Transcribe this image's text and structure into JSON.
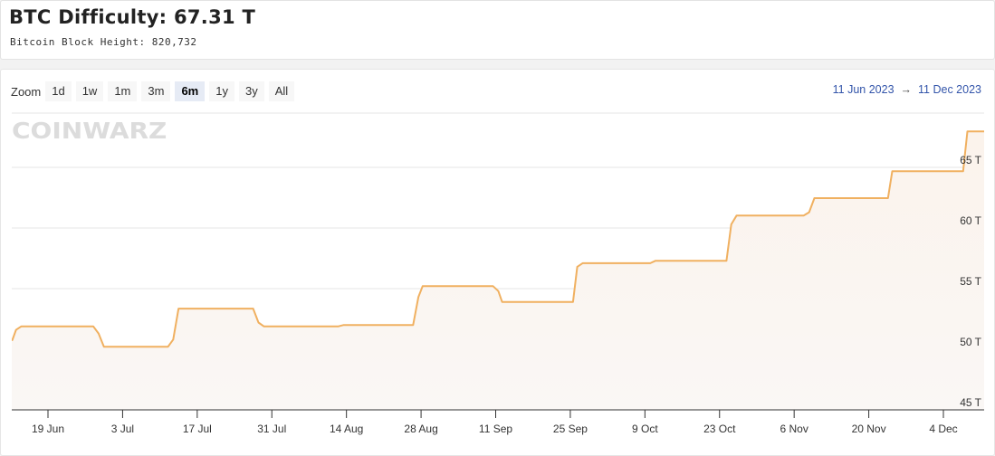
{
  "header": {
    "title": "BTC Difficulty: 67.31 T",
    "subtitle": "Bitcoin Block Height: 820,732"
  },
  "toolbar": {
    "zoom_label": "Zoom",
    "buttons": [
      {
        "label": "1d",
        "active": false
      },
      {
        "label": "1w",
        "active": false
      },
      {
        "label": "1m",
        "active": false
      },
      {
        "label": "3m",
        "active": false
      },
      {
        "label": "6m",
        "active": true
      },
      {
        "label": "1y",
        "active": false
      },
      {
        "label": "3y",
        "active": false
      },
      {
        "label": "All",
        "active": false
      }
    ]
  },
  "range": {
    "from": "11 Jun 2023",
    "arrow": "→",
    "to": "11 Dec 2023"
  },
  "watermark": "COINWARZ",
  "colors": {
    "line": "#f0b060",
    "area": "#fbf3ec",
    "range_text": "#3355aa",
    "active_button": "#e6ebf5"
  },
  "chart_data": {
    "type": "area",
    "title": "BTC Difficulty",
    "xlabel": "",
    "ylabel": "",
    "ylim": [
      45,
      69
    ],
    "y_unit": "T",
    "y_ticks": [
      45,
      50,
      55,
      60,
      65
    ],
    "y_tick_labels": [
      "45 T",
      "50 T",
      "55 T",
      "60 T",
      "65 T"
    ],
    "x_range_days": [
      0,
      183
    ],
    "x_ticks": [
      {
        "day": 8,
        "label": "19 Jun"
      },
      {
        "day": 22,
        "label": "3 Jul"
      },
      {
        "day": 36,
        "label": "17 Jul"
      },
      {
        "day": 50,
        "label": "31 Jul"
      },
      {
        "day": 64,
        "label": "14 Aug"
      },
      {
        "day": 78,
        "label": "28 Aug"
      },
      {
        "day": 92,
        "label": "11 Sep"
      },
      {
        "day": 106,
        "label": "25 Sep"
      },
      {
        "day": 120,
        "label": "9 Oct"
      },
      {
        "day": 134,
        "label": "23 Oct"
      },
      {
        "day": 148,
        "label": "6 Nov"
      },
      {
        "day": 162,
        "label": "20 Nov"
      },
      {
        "day": 176,
        "label": "4 Dec"
      }
    ],
    "grid": true,
    "legend": "none",
    "series": [
      {
        "name": "Difficulty (T)",
        "points": [
          [
            0,
            50.75
          ],
          [
            1.3,
            50.75
          ],
          [
            2,
            51.6
          ],
          [
            3,
            51.89
          ],
          [
            16.5,
            51.89
          ],
          [
            17.5,
            51.3
          ],
          [
            18.5,
            50.2
          ],
          [
            30.5,
            50.2
          ],
          [
            31.5,
            50.8
          ],
          [
            32.5,
            53.35
          ],
          [
            46.5,
            53.35
          ],
          [
            47.5,
            52.2
          ],
          [
            48.5,
            51.89
          ],
          [
            62.5,
            51.89
          ],
          [
            63.5,
            52.0
          ],
          [
            76.5,
            52.0
          ],
          [
            77.5,
            54.3
          ],
          [
            78.3,
            55.2
          ],
          [
            91.5,
            55.2
          ],
          [
            92.5,
            54.8
          ],
          [
            93.2,
            53.9
          ],
          [
            106.5,
            53.9
          ],
          [
            107.3,
            56.8
          ],
          [
            108.3,
            57.1
          ],
          [
            121,
            57.1
          ],
          [
            122,
            57.3
          ],
          [
            135.3,
            57.3
          ],
          [
            136.2,
            60.3
          ],
          [
            137.2,
            61.03
          ],
          [
            149.8,
            61.03
          ],
          [
            150.8,
            61.3
          ],
          [
            151.8,
            62.46
          ],
          [
            165.6,
            62.46
          ],
          [
            166.4,
            64.68
          ],
          [
            179.7,
            64.68
          ],
          [
            180.5,
            67.96
          ],
          [
            193.5,
            67.96
          ],
          [
            195,
            67.31
          ],
          [
            197,
            67.31
          ]
        ]
      }
    ]
  }
}
